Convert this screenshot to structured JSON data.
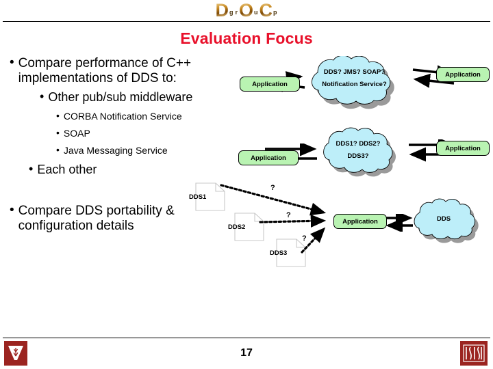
{
  "logo": {
    "big_letters": [
      "D",
      "O",
      "C"
    ],
    "small_letters": [
      "g",
      "r",
      "u",
      "p"
    ],
    "alt": "DOC group"
  },
  "title": "Evaluation Focus",
  "bullets": [
    {
      "marker": "•",
      "text": "Compare performance of C++ implementations of DDS to:"
    },
    {
      "marker": "•",
      "text": "Other pub/sub middleware"
    },
    {
      "marker": "•",
      "text": "CORBA Notification Service"
    },
    {
      "marker": "•",
      "text": "SOAP"
    },
    {
      "marker": "•",
      "text": "Java Messaging Service"
    },
    {
      "marker": "•",
      "text": "Each other"
    },
    {
      "marker": "•",
      "text": "Compare DDS portability & configuration details"
    }
  ],
  "diagram_top": {
    "left_app": "Application",
    "right_app": "Application",
    "cloud_line1": "DDS? JMS? SOAP?",
    "cloud_line2": "Notification Service?"
  },
  "diagram_middle": {
    "left_app": "Application",
    "right_app": "Application",
    "cloud_line1": "DDS1?   DDS2?",
    "cloud_line2": "DDS3?"
  },
  "diagram_bottom": {
    "docs": [
      "DDS1",
      "DDS2",
      "DDS3"
    ],
    "question_marks": [
      "?",
      "?",
      "?"
    ],
    "app": "Application",
    "cloud_label": "DDS"
  },
  "footer": {
    "page_number": "17",
    "left_logo": "Vanderbilt V",
    "right_logo": "ISIS"
  },
  "colors": {
    "title_red": "#e8102a",
    "app_green": "#b9f3b2",
    "cloud_blue": "#bdeef9",
    "cloud_shadow": "#9a9a9a",
    "logo_maroon": "#9b2420"
  }
}
